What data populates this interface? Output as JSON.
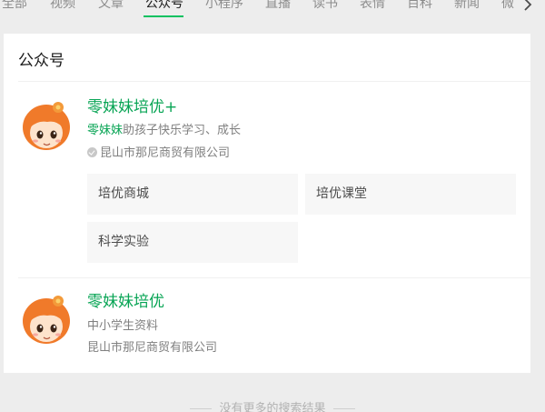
{
  "tabs": [
    {
      "label": "全部",
      "active": false
    },
    {
      "label": "视频",
      "active": false
    },
    {
      "label": "文章",
      "active": false
    },
    {
      "label": "公众号",
      "active": true
    },
    {
      "label": "小程序",
      "active": false
    },
    {
      "label": "直播",
      "active": false
    },
    {
      "label": "读书",
      "active": false
    },
    {
      "label": "表情",
      "active": false
    },
    {
      "label": "百科",
      "active": false
    },
    {
      "label": "新闻",
      "active": false
    },
    {
      "label": "微",
      "active": false
    }
  ],
  "section": {
    "title": "公众号"
  },
  "accounts": [
    {
      "name": "零妹妹培优+",
      "desc_highlight": "零妹妹",
      "desc_rest": "助孩子快乐学习、成长",
      "company": "昆山市那尼商贸有限公司",
      "verified": true,
      "menu": [
        "培优商城",
        "培优课堂",
        "科学实验"
      ]
    },
    {
      "name": "零妹妹培优",
      "desc": "中小学生资料",
      "company": "昆山市那尼商贸有限公司",
      "verified": false
    }
  ],
  "footer": {
    "text": "没有更多的搜索结果"
  },
  "colors": {
    "accent": "#07c160",
    "name_green": "#07a454",
    "bg": "#ededed",
    "menu_bg": "#f7f7f7"
  },
  "icons": {
    "more": "chevron-right-icon",
    "verified": "verified-check-icon",
    "avatar": "cartoon-girl-avatar"
  }
}
